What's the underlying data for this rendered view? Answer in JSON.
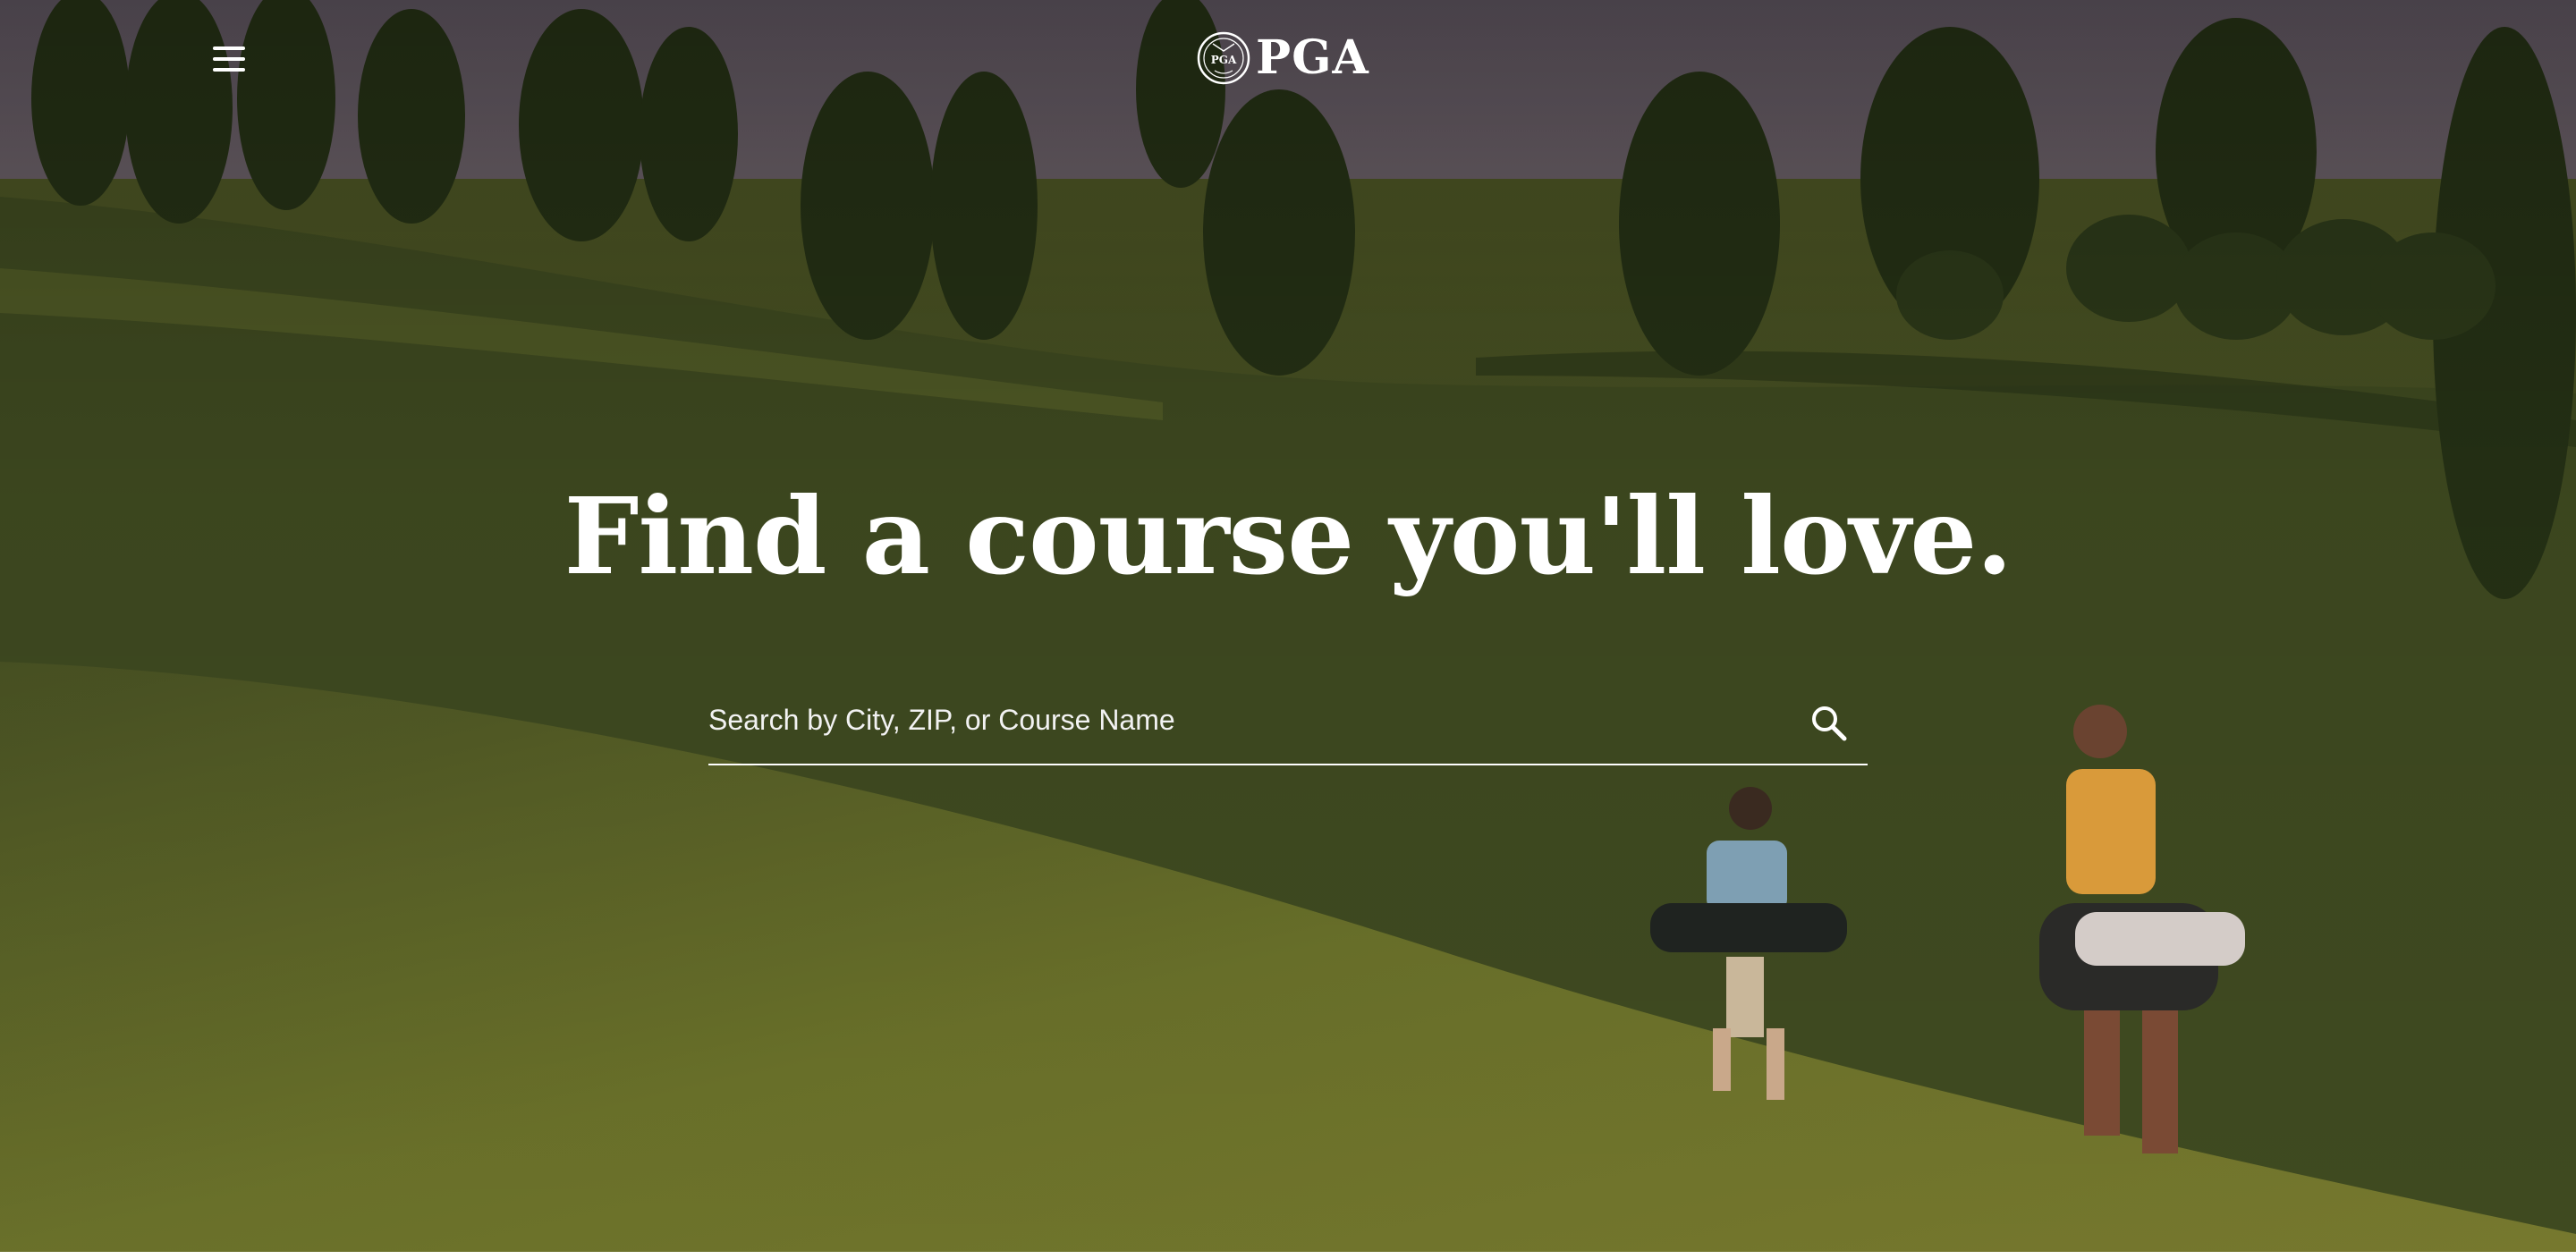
{
  "header": {
    "menu_icon": "hamburger-menu-icon",
    "logo": {
      "seal_text": "PGA",
      "wordmark": "PGA"
    }
  },
  "hero": {
    "headline": "Find a course you'll love.",
    "search": {
      "placeholder": "Search by City, ZIP, or Course Name",
      "value": "",
      "icon": "search-icon"
    }
  },
  "colors": {
    "text": "#ffffff",
    "grass": "#6e7a2c",
    "sky": "#b9a79f"
  }
}
